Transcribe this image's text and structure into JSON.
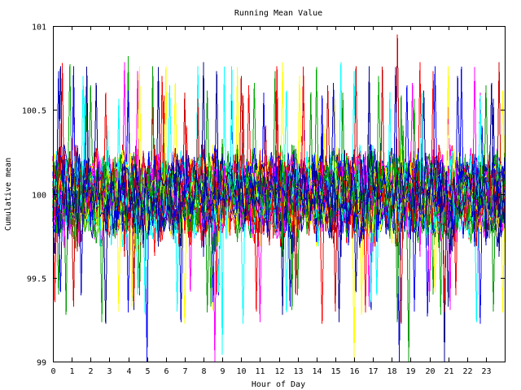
{
  "chart_data": {
    "type": "line",
    "title": "Running Mean Value",
    "xlabel": "Hour of Day",
    "ylabel": "Cumulative mean",
    "xlim": [
      0,
      24
    ],
    "ylim": [
      99,
      101
    ],
    "xticks": [
      "0",
      "1",
      "2",
      "3",
      "4",
      "5",
      "6",
      "7",
      "8",
      "9",
      "10",
      "11",
      "12",
      "13",
      "14",
      "15",
      "16",
      "17",
      "18",
      "19",
      "20",
      "21",
      "22",
      "23"
    ],
    "yticks": [
      "99",
      "99.5",
      "100",
      "100.5",
      "101"
    ],
    "grid": false,
    "legend": "none",
    "series_count": 40,
    "points_per_series": 240,
    "series_center": 100,
    "series_typical_range": [
      99.6,
      100.4
    ],
    "series_extreme_range": [
      99.0,
      100.95
    ],
    "series_colors": [
      "#ff0000",
      "#00aa00",
      "#0000ff",
      "#ff00ff",
      "#00ffff",
      "#ffff00",
      "#cc0000",
      "#0000cc",
      "#009900",
      "#000088"
    ],
    "notable_values": [
      {
        "x": 0.5,
        "y": 100.78
      },
      {
        "x": 4.0,
        "y": 100.82
      },
      {
        "x": 5.0,
        "y": 99.0
      },
      {
        "x": 8.6,
        "y": 99.0
      },
      {
        "x": 9.0,
        "y": 99.04
      },
      {
        "x": 16.0,
        "y": 99.0
      },
      {
        "x": 18.3,
        "y": 100.95
      },
      {
        "x": 18.4,
        "y": 99.0
      },
      {
        "x": 18.9,
        "y": 99.0
      },
      {
        "x": 20.8,
        "y": 99.0
      }
    ]
  }
}
